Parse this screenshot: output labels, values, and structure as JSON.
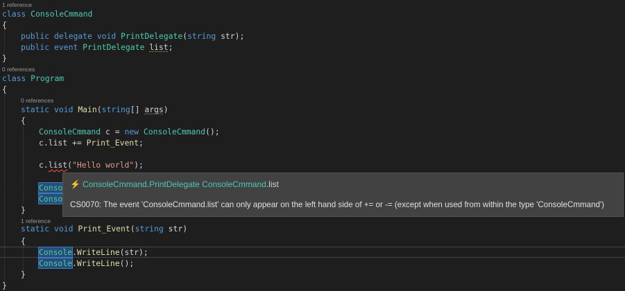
{
  "code_lens": {
    "class1": "1 reference",
    "class2": "0 references",
    "main": "0 references",
    "print_event": "1 reference"
  },
  "lines": {
    "l1_kw": "class",
    "l1_name": "ConsoleCmmand",
    "open_brace": "{",
    "close_brace": "}",
    "l3_public": "public",
    "l3_delegate": "delegate",
    "l3_void": "void",
    "l3_name": "PrintDelegate",
    "l3_paren_open": "(",
    "l3_string": "string",
    "l3_param": " str",
    "l3_end": ");",
    "l4_public": "public",
    "l4_event": "event",
    "l4_type": "PrintDelegate",
    "l4_field": "list",
    "l4_end": ";",
    "l6_kw": "class",
    "l6_name": "Program",
    "l8_static": "static",
    "l8_void": "void",
    "l8_name": "Main",
    "l8_open": "(",
    "l8_string": "string",
    "l8_arr": "[] ",
    "l8_args": "args",
    "l8_close": ")",
    "l10_type": "ConsoleCmmand",
    "l10_var": " c = ",
    "l10_new": "new",
    "l10_ctor": " ConsoleCmmand",
    "l10_end": "();",
    "l11_a": "c.list += ",
    "l11_fn": "Print_Event",
    "l11_end": ";",
    "l13_a": "c.",
    "l13_list": "list",
    "l13_open": "(",
    "l13_str": "\"Hello world\"",
    "l13_end": ");",
    "l14_partial": "Conso",
    "l15_partial": "Conso",
    "l18_static": "static",
    "l18_void": "void",
    "l18_name": "Print_Event",
    "l18_open": "(",
    "l18_string": "string",
    "l18_param": " str",
    "l18_close": ")",
    "l20_type": "Console",
    "l20_dot": ".",
    "l20_fn": "WriteLine",
    "l20_args": "(str);",
    "l21_type": "Console",
    "l21_dot": ".",
    "l21_fn": "WriteLine",
    "l21_args": "();"
  },
  "tooltip": {
    "icon": "lightning-icon",
    "sig_type1": "ConsoleCmmand",
    "sig_dot1": ".",
    "sig_type2": "PrintDelegate",
    "sig_space": " ",
    "sig_type3": "ConsoleCmmand",
    "sig_member": ".list",
    "error": "CS0070: The event 'ConsoleCmmand.list' can only appear on the left hand side of += or -= (except when used from within the type 'ConsoleCmmand')"
  },
  "colors": {
    "background": "#1e1e1e",
    "keyword": "#569cd6",
    "type": "#4ec9b0",
    "method": "#dcdcaa",
    "string": "#d69d85",
    "tooltip_bg": "#424242"
  }
}
